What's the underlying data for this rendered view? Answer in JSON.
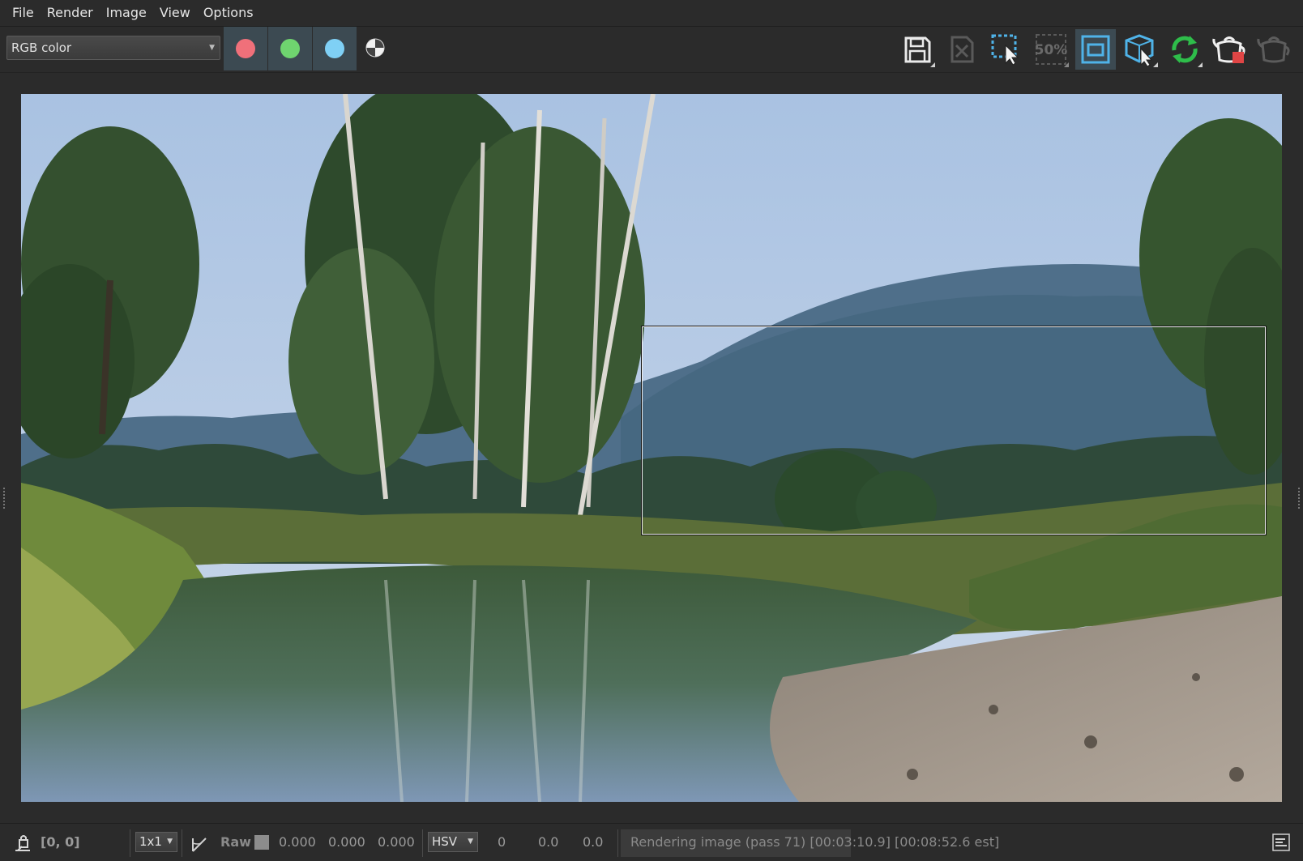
{
  "menu": [
    "File",
    "Render",
    "Image",
    "View",
    "Options"
  ],
  "toolbar": {
    "channel_select": "RGB color",
    "channel_buttons": [
      {
        "name": "red-channel",
        "color": "#f0707a"
      },
      {
        "name": "green-channel",
        "color": "#6fd46f"
      },
      {
        "name": "blue-channel",
        "color": "#7fd0f5"
      }
    ],
    "alpha_icon": "alpha-toggle-icon",
    "zoom_icon_label": "50%",
    "right_icons": [
      "save-image-icon",
      "clear-image-icon",
      "region-select-icon",
      "zoom-50-icon",
      "fit-frame-icon",
      "track-mouse-icon",
      "update-refresh-icon",
      "render-last-icon",
      "render-teapot-icon"
    ]
  },
  "status": {
    "coords": "[0, 0]",
    "sample_size": "1x1",
    "mode": "Raw",
    "rgb_values": [
      "0.000",
      "0.000",
      "0.000"
    ],
    "color_space": "HSV",
    "hsv_values": [
      "0",
      "0.0",
      "0.0"
    ],
    "render_status": "Rendering image (pass 71) [00:03:10.9] [00:08:52.6 est]"
  },
  "colors": {
    "background": "#2b2b2b",
    "accent_active": "#3c4a52",
    "icon_blue": "#4fb3e8",
    "icon_green": "#2ebd4a",
    "icon_red": "#e04545"
  }
}
